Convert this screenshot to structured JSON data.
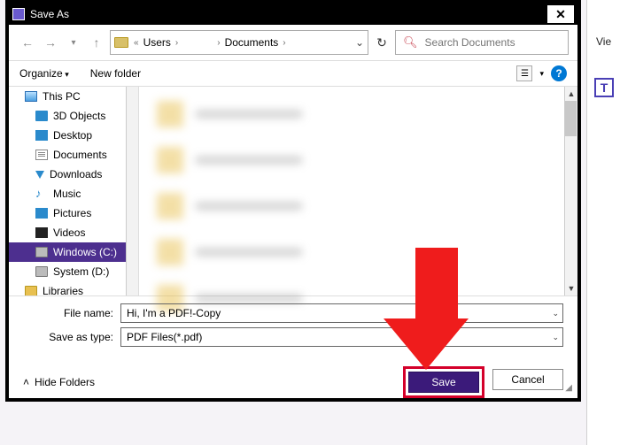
{
  "titlebar": {
    "title": "Save As"
  },
  "nav": {
    "path_segments": [
      "Users",
      "",
      "Documents"
    ],
    "refresh_icon": "↻"
  },
  "search": {
    "placeholder": "Search Documents"
  },
  "toolbar": {
    "organize_label": "Organize",
    "newfolder_label": "New folder"
  },
  "tree": {
    "items": [
      {
        "label": "This PC",
        "icon": "pc"
      },
      {
        "label": "3D Objects",
        "icon": "3d"
      },
      {
        "label": "Desktop",
        "icon": "desk"
      },
      {
        "label": "Documents",
        "icon": "doc"
      },
      {
        "label": "Downloads",
        "icon": "dl"
      },
      {
        "label": "Music",
        "icon": "mus"
      },
      {
        "label": "Pictures",
        "icon": "pic"
      },
      {
        "label": "Videos",
        "icon": "vid"
      },
      {
        "label": "Windows (C:)",
        "icon": "drv",
        "selected": true
      },
      {
        "label": "System (D:)",
        "icon": "drv"
      },
      {
        "label": "Libraries",
        "icon": "fold"
      }
    ]
  },
  "form": {
    "filename_label": "File name:",
    "filename_value": "Hi, I'm a PDF!-Copy",
    "type_label": "Save as type:",
    "type_value": "PDF Files(*.pdf)"
  },
  "footer": {
    "hide_label": "Hide Folders",
    "save_label": "Save",
    "cancel_label": "Cancel"
  },
  "background": {
    "view_label": "Vie",
    "text_icon": "T"
  }
}
